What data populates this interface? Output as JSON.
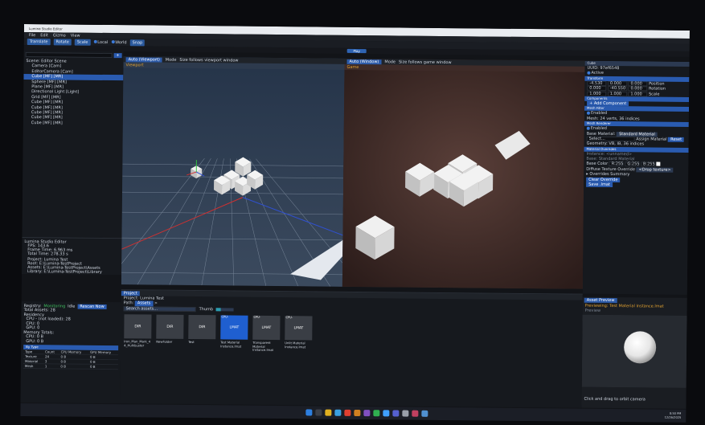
{
  "window": {
    "title": "Lumina Studio Editor"
  },
  "menu": [
    "File",
    "Edit",
    "Gizmo",
    "View"
  ],
  "toolbar": {
    "translate": "Translate",
    "rotate": "Rotate",
    "scale": "Scale",
    "local": "Local",
    "world": "World",
    "snap": "Snap"
  },
  "play": "Play",
  "hierarchy": {
    "add": "+",
    "items": [
      {
        "label": "Scene: Editor Scene",
        "indent": 0
      },
      {
        "label": "Camera   [Cam]",
        "indent": 1
      },
      {
        "label": "EditorCamera   [Cam]",
        "indent": 1
      },
      {
        "label": "Cube   [MF] [MR]",
        "indent": 1,
        "selected": true
      },
      {
        "label": "Sphere   [MF] [MR]",
        "indent": 1
      },
      {
        "label": "Plane   [MF] [MR]",
        "indent": 1
      },
      {
        "label": "Directional Light   [Light]",
        "indent": 1
      },
      {
        "label": "Grid   [MF] [MR]",
        "indent": 1
      },
      {
        "label": "Cube   [MF] [MR]",
        "indent": 1
      },
      {
        "label": "Cube   [MF] [MR]",
        "indent": 1
      },
      {
        "label": "Cube   [MF] [MR]",
        "indent": 1
      },
      {
        "label": "Cube   [MF] [MR]",
        "indent": 1
      },
      {
        "label": "Cube   [MF] [MR]",
        "indent": 1
      }
    ]
  },
  "stats": {
    "title": "Lumina Studio Editor",
    "fps": "FPS: 143.6",
    "frame": "Frame Time: 6.963 ms",
    "total": "Total Time: 278.33 s",
    "project": "Project: Lumina Test",
    "root": "Root: E:\\Lumina-TestProject",
    "assets": "Assets: E:\\Lumina-TestProject\\Assets",
    "library": "Library: E:\\Lumina-TestProject\\Library"
  },
  "registry": {
    "label": "Registry:",
    "monitoring": "Monitoring",
    "idle": "Idle",
    "rescan": "Rescan Now",
    "total": "Total Assets: 28",
    "residency": "Residency",
    "cpu_not_loaded": "CPU - (not loaded): 28",
    "cpu": "CPU: 0",
    "gpu": "GPU: 0",
    "mem_totals": "Memory Totals:",
    "cpu_mem": "CPU: 0 B",
    "gpu_mem": "GPU: 0 B",
    "by_type": "By Type",
    "headers": [
      "Type",
      "Count",
      "CPU Memory",
      "GPU Memory"
    ],
    "rows": [
      [
        "Texture",
        "24",
        "0 B",
        "0 B"
      ],
      [
        "Material",
        "3",
        "0 B",
        "0 B"
      ],
      [
        "Mesh",
        "1",
        "0 B",
        "0 B"
      ]
    ]
  },
  "viewport": {
    "tab": "Auto (Viewport)",
    "mode": "Mode",
    "size": "Size follows viewport window",
    "label": "Viewport"
  },
  "game": {
    "tab": "Auto (Window)",
    "mode": "Mode",
    "size": "Size follows game window",
    "label": "Game"
  },
  "inspector": {
    "title": "Cube",
    "uuid": "UUID: 97ef6548",
    "active": "Active",
    "transform": "Transform",
    "pos": [
      "-4.530",
      "0.000",
      "0.000"
    ],
    "rot": [
      "0.000",
      "-40.550",
      "0.000"
    ],
    "scale": [
      "1.000",
      "1.000",
      "1.000"
    ],
    "pos_label": "Position",
    "rot_label": "Rotation",
    "scale_label": "Scale",
    "components": "Components",
    "add_component": "+ Add Component",
    "mesh_filter": "Mesh Filter",
    "enabled": "Enabled",
    "mesh_info": "Mesh: 24 verts, 36 indices",
    "mesh_renderer": "Mesh Renderer",
    "enabled2": "Enabled",
    "base_material_label": "Base Material:",
    "base_material": "Standard Material",
    "select": "Select...",
    "assign": "Assign Material",
    "reset": "Reset",
    "geometry": "Geometry: VB, IB, 36 indices",
    "mat_overrides": "Material Overrides",
    "instance": "Instance: <unnamed>",
    "base": "Base: Standard Material",
    "base_color": "Base Color",
    "base_color_vals": [
      "R:255",
      "G:255",
      "B:255"
    ],
    "diffuse": "Diffuse Texture Override",
    "drop": "<Drop texture>",
    "overrides_summary": "Overrides Summary",
    "clear": "Clear Override",
    "save": "Save .lmat"
  },
  "project": {
    "tab": "Project",
    "title": "Project: Lumina Test",
    "path_label": "Path:",
    "path": "Assets",
    "path_sep": ">",
    "search_placeholder": "Search assets...",
    "thumb": "Thumb",
    "assets": [
      {
        "thumb": "DIR",
        "label": "Iron_Man_Mark_4 4_Hulkbuster",
        "selected": false,
        "tag": ""
      },
      {
        "thumb": "DIR",
        "label": "NewFolder",
        "selected": false,
        "tag": ""
      },
      {
        "thumb": "DIR",
        "label": "Test",
        "selected": false,
        "tag": ""
      },
      {
        "thumb": "LMAT",
        "label": "Test Material Instance.lmat",
        "selected": true,
        "tag": "CPU-"
      },
      {
        "thumb": "LMAT",
        "label": "Transparent Material Instance.lmat",
        "selected": false,
        "tag": "CPU-"
      },
      {
        "thumb": "LMAT",
        "label": "Unlit Material Instance.lmat",
        "selected": false,
        "tag": "CPU-"
      }
    ]
  },
  "preview": {
    "title": "Asset Preview",
    "name": "Previewing: Test Material Instance.lmat",
    "sub": "Preview",
    "hint": "Click and drag to orbit camera"
  },
  "taskbar": {
    "time": "8:50 PM",
    "date": "12/26/2025"
  },
  "colors": {
    "accent": "#2a5bb0",
    "header": "#2c3a52",
    "viewport_bg": "#2d3a4d",
    "game_bg": "#3e2b28",
    "selected_asset": "#1f5fd0"
  }
}
